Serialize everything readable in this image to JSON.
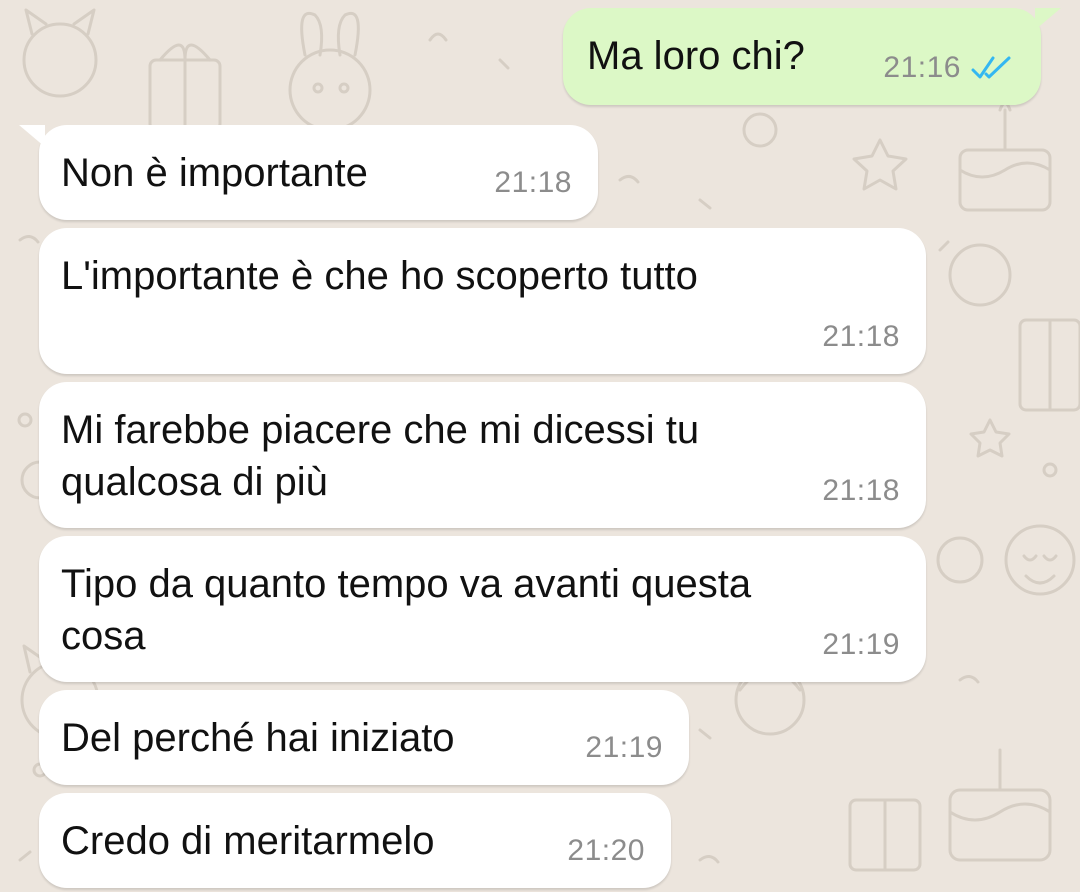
{
  "chat": {
    "theme": {
      "background": "#ECE5DD",
      "incoming_bubble": "#FFFFFF",
      "outgoing_bubble": "#DCF8C6",
      "read_tick_color": "#34B7F1"
    },
    "messages": [
      {
        "direction": "outgoing",
        "text": "Ma loro chi?",
        "time": "21:16",
        "status": "read",
        "status_icon": "double-check-icon"
      },
      {
        "direction": "incoming",
        "text": "Non è importante",
        "time": "21:18"
      },
      {
        "direction": "incoming",
        "text": "L'importante è che ho scoperto tutto",
        "time": "21:18"
      },
      {
        "direction": "incoming",
        "text": "Mi farebbe piacere che mi dicessi tu\nqualcosa di più",
        "time": "21:18"
      },
      {
        "direction": "incoming",
        "text": "Tipo da quanto tempo va avanti questa\ncosa",
        "time": "21:19"
      },
      {
        "direction": "incoming",
        "text": "Del perché hai iniziato",
        "time": "21:19"
      },
      {
        "direction": "incoming",
        "text": "Credo di meritarmelo",
        "time": "21:20"
      }
    ]
  }
}
